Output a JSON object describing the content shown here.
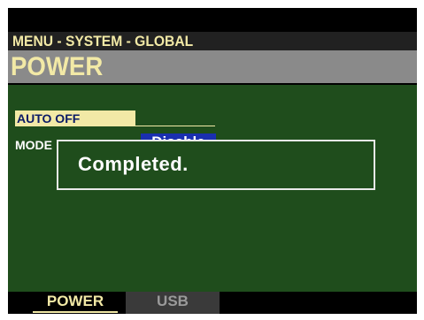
{
  "header": {
    "breadcrumb": "MENU - SYSTEM - GLOBAL",
    "title": "POWER"
  },
  "params": {
    "auto_off_label": "AUTO OFF",
    "mode_label": "MODE",
    "mode_value": "Disable"
  },
  "popup": {
    "message": "Completed."
  },
  "tabs": [
    {
      "label": "POWER",
      "active": true
    },
    {
      "label": "USB",
      "active": false
    }
  ],
  "colors": {
    "screen_bg": "#000000",
    "content_bg": "#1f4d1c",
    "accent_yellow": "#f2e9a6",
    "value_blue": "#1a2fb0",
    "title_gray": "#8a8a8a"
  }
}
